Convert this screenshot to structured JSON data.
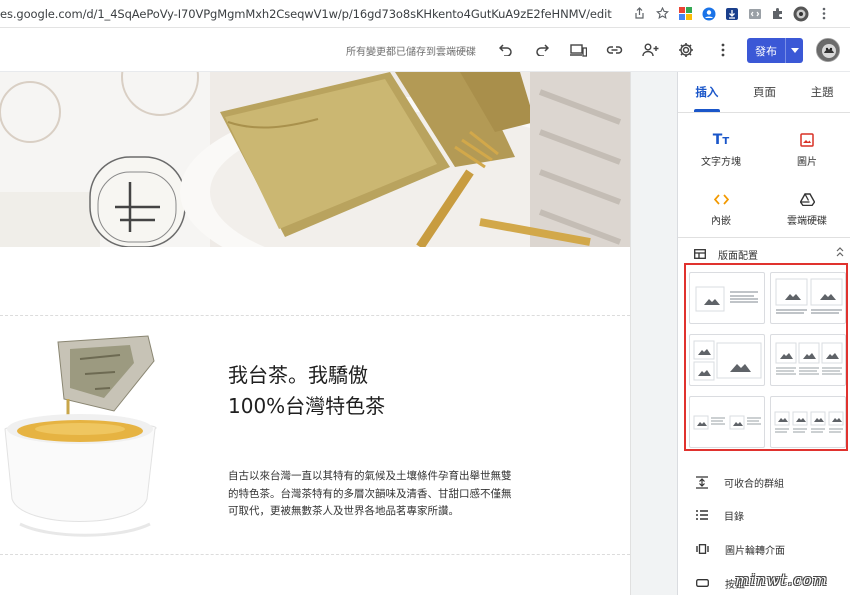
{
  "browser": {
    "url": "es.google.com/d/1_4SqAePoVy-I70VPgMgmMxh2CseqwV1w/p/16gd73o8sKHkento4GutKuA9zE2feHNMV/edit"
  },
  "toolbar": {
    "saved_status": "所有變更都已儲存到雲端硬碟",
    "publish_label": "發布"
  },
  "page": {
    "headline_line1": "我台茶。我驕傲",
    "headline_line2": "100%台灣特色茶",
    "body_line1": "自古以來台灣一直以其特有的氣候及土壤條件孕育出舉世無雙",
    "body_line2": "的特色茶。台灣茶特有的多層次韻味及清香、甘甜口感不僅無",
    "body_line3": "可取代，更被無數茶人及世界各地品茗專家所讚。"
  },
  "panel": {
    "tabs": [
      {
        "label": "插入",
        "active": true
      },
      {
        "label": "頁面",
        "active": false
      },
      {
        "label": "主題",
        "active": false
      }
    ],
    "insert": {
      "text_box": "文字方塊",
      "image": "圖片",
      "embed": "內嵌",
      "drive": "雲端硬碟"
    },
    "layouts_label": "版面配置",
    "items": {
      "collapsible": "可收合的群組",
      "toc": "目錄",
      "carousel": "圖片輪轉介面",
      "button": "按鈕"
    }
  },
  "colors": {
    "accent": "#1a56c9",
    "publish": "#3b58d6",
    "highlight": "#e0322e",
    "image_icon": "#d93025",
    "embed_icon": "#f29900"
  },
  "watermark": "minwt.com"
}
